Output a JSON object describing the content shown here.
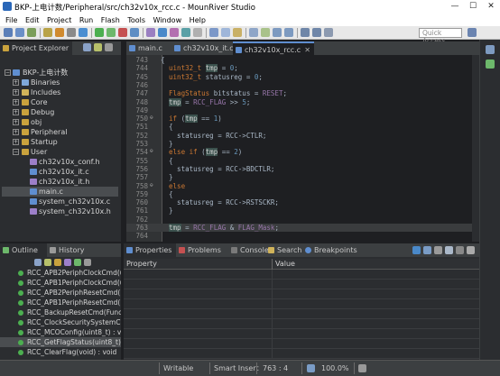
{
  "window": {
    "title": "BKP-上电计数/Peripheral/src/ch32v10x_rcc.c - MounRiver Studio",
    "minimize": "—",
    "maximize": "☐",
    "close": "✕"
  },
  "menu": [
    "File",
    "Edit",
    "Project",
    "Run",
    "Flash",
    "Tools",
    "Window",
    "Help"
  ],
  "toolbar": {
    "quick_access_placeholder": "Quick Access"
  },
  "project_explorer": {
    "tab_label": "Project Explorer",
    "root": "BKP-上电计数",
    "items": [
      "Binaries",
      "Includes",
      "Core",
      "Debug",
      "obj",
      "Peripheral",
      "Startup",
      "User"
    ],
    "user_children": [
      "ch32v10x_conf.h",
      "ch32v10x_it.c",
      "ch32v10x_it.h",
      "main.c",
      "system_ch32v10x.c",
      "system_ch32v10x.h"
    ],
    "selected": "main.c"
  },
  "editor": {
    "tabs": [
      "main.c",
      "ch32v10x_it.c",
      "ch32v10x_rcc.c"
    ],
    "active_tab": "ch32v10x_rcc.c",
    "lines": [
      {
        "n": "743",
        "t": "{"
      },
      {
        "n": "744",
        "t": "  uint32_t tmp = 0;"
      },
      {
        "n": "745",
        "t": "  uint32_t statusreg = 0;"
      },
      {
        "n": "746",
        "t": ""
      },
      {
        "n": "747",
        "t": "  FlagStatus bitstatus = RESET;"
      },
      {
        "n": "748",
        "t": "  tmp = RCC_FLAG >> 5;"
      },
      {
        "n": "749",
        "t": ""
      },
      {
        "n": "750",
        "t": "  if (tmp == 1)"
      },
      {
        "n": "751",
        "t": "  {"
      },
      {
        "n": "752",
        "t": "    statusreg = RCC->CTLR;"
      },
      {
        "n": "753",
        "t": "  }"
      },
      {
        "n": "754",
        "t": "  else if (tmp == 2)"
      },
      {
        "n": "755",
        "t": "  {"
      },
      {
        "n": "756",
        "t": "    statusreg = RCC->BDCTLR;"
      },
      {
        "n": "757",
        "t": "  }"
      },
      {
        "n": "758",
        "t": "  else"
      },
      {
        "n": "759",
        "t": "  {"
      },
      {
        "n": "760",
        "t": "    statusreg = RCC->RSTSCKR;"
      },
      {
        "n": "761",
        "t": "  }"
      },
      {
        "n": "762",
        "t": ""
      },
      {
        "n": "763",
        "t": "  tmp = RCC_FLAG & FLAG_Mask;"
      },
      {
        "n": "764",
        "t": ""
      }
    ]
  },
  "outline": {
    "tabs": [
      "Outline",
      "History"
    ],
    "items": [
      "RCC_APB2PeriphClockCmd(ui",
      "RCC_APB1PeriphClockCmd(u",
      "RCC_APB2PeriphResetCmd(u",
      "RCC_APB1PeriphResetCmd(u",
      "RCC_BackupResetCmd(Functi",
      "RCC_ClockSecuritySystemCm",
      "RCC_MCOConfig(uint8_t) : vo",
      "RCC_GetFlagStatus(uint8_t) :",
      "RCC_ClearFlag(void) : void"
    ]
  },
  "properties": {
    "tabs": [
      "Properties",
      "Problems",
      "Console",
      "Search",
      "Breakpoints"
    ],
    "columns": [
      "Property",
      "Value"
    ]
  },
  "status": {
    "mode": "Writable",
    "insert": "Smart Insert",
    "position": "763 : 4",
    "zoom": "100.0%"
  }
}
